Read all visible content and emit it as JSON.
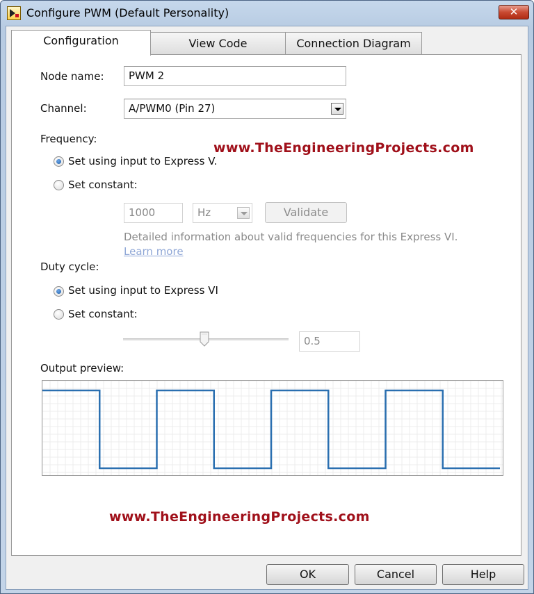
{
  "window": {
    "title": "Configure PWM (Default Personality)",
    "close_glyph": "✕"
  },
  "tabs": [
    {
      "label": "Configuration",
      "active": true
    },
    {
      "label": "View Code",
      "active": false
    },
    {
      "label": "Connection Diagram",
      "active": false
    }
  ],
  "node": {
    "label": "Node name:",
    "value": "PWM 2"
  },
  "channel": {
    "label": "Channel:",
    "value": "A/PWM0 (Pin 27)"
  },
  "frequency": {
    "label": "Frequency:",
    "option_input": "Set using input to Express V.",
    "option_constant": "Set constant:",
    "selected": "input",
    "value": "1000",
    "unit": "Hz",
    "validate_label": "Validate",
    "info_text": "Detailed information about valid frequencies for this Express VI.",
    "learn_more": "Learn more"
  },
  "duty": {
    "label": "Duty cycle:",
    "option_input": "Set using input to Express VI",
    "option_constant": "Set constant:",
    "selected": "input",
    "value": "0.5",
    "slider_value": 0.5
  },
  "preview": {
    "label": "Output preview:",
    "waveform": "square",
    "cycles": 4,
    "duty": 0.5,
    "line_color": "#2a6fb0"
  },
  "watermark": "www.TheEngineeringProjects.com",
  "footer": {
    "ok": "OK",
    "cancel": "Cancel",
    "help": "Help"
  },
  "colors": {
    "titlebar": "#c6d8ec",
    "watermark": "#a0101a",
    "link": "#8ea6d6"
  }
}
